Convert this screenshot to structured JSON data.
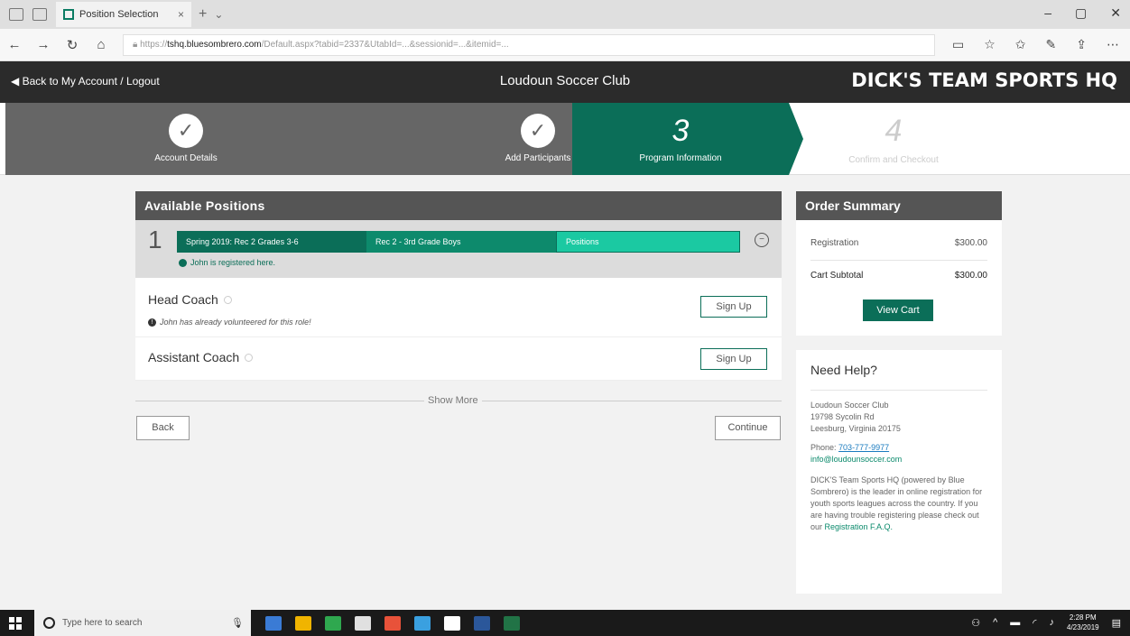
{
  "browser": {
    "tab_title": "Position Selection",
    "url_host": "tshq.bluesombrero.com",
    "url_rest": "/Default.aspx?tabid=2337&UtabId=...&sessionid=...&itemid=...",
    "close_glyph": "×",
    "new_tab_glyph": "+",
    "dropdown_glyph": "⌄",
    "nav_icons": [
      "←",
      "→",
      "↻",
      "⌂"
    ]
  },
  "header": {
    "back_link": "Back to My Account / Logout",
    "club_name": "Loudoun Soccer Club",
    "brand": "DICK'S TEAM SPORTS HQ"
  },
  "steps": [
    {
      "label": "Account Details",
      "state": "done"
    },
    {
      "label": "Add Participants",
      "state": "done"
    },
    {
      "num": "3",
      "label": "Program Information",
      "state": "active"
    },
    {
      "num": "4",
      "label": "Confirm and Checkout",
      "state": "todo"
    }
  ],
  "check_glyph": "✓",
  "positions_panel": {
    "title": "Available Positions",
    "program_num": "1",
    "crumbs": [
      "Spring 2019: Rec 2 Grades 3-6",
      "Rec 2 - 3rd Grade Boys",
      "Positions"
    ],
    "collapse_glyph": "−",
    "registered_text": "John is registered here.",
    "rows": [
      {
        "title": "Head Coach",
        "note": "John has already volunteered for this role!",
        "button": "Sign Up"
      },
      {
        "title": "Assistant Coach",
        "button": "Sign Up"
      }
    ],
    "note_glyph": "!",
    "show_more": "Show More",
    "back": "Back",
    "continue": "Continue"
  },
  "order_summary": {
    "title": "Order Summary",
    "registration_label": "Registration",
    "registration_value": "$300.00",
    "subtotal_label": "Cart Subtotal",
    "subtotal_value": "$300.00",
    "view_cart": "View Cart"
  },
  "help": {
    "title": "Need Help?",
    "org": "Loudoun Soccer Club",
    "street": "19798 Sycolin Rd",
    "city": "Leesburg, Virginia 20175",
    "phone_label": "Phone:",
    "phone": "703-777-9977",
    "email": "info@loudounsoccer.com",
    "about": "DICK'S Team Sports HQ (powered by Blue Sombrero) is the leader in online registration for youth sports leagues across the country. If you are having trouble registering please check out our",
    "faq_link": "Registration F.A.Q."
  },
  "taskbar": {
    "search_placeholder": "Type here to search",
    "time": "2:28 PM",
    "date": "4/23/2019",
    "app_colors": [
      "#3a7bd5",
      "#f0b400",
      "#2fa84f",
      "#e0e0e0",
      "#e8523a",
      "#3aa0e0",
      "#ffffff",
      "#2b579a",
      "#217346"
    ]
  }
}
